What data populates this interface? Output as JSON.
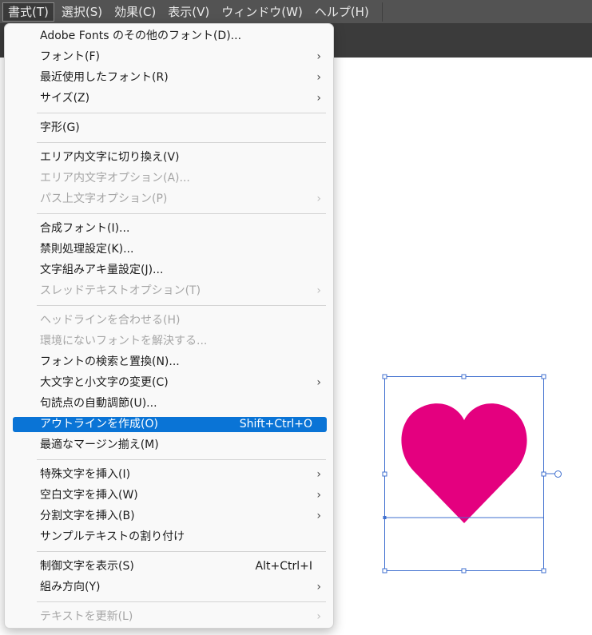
{
  "menubar": {
    "items": [
      {
        "label": "書式(T)"
      },
      {
        "label": "選択(S)"
      },
      {
        "label": "効果(C)"
      },
      {
        "label": "表示(V)"
      },
      {
        "label": "ウィンドウ(W)"
      },
      {
        "label": "ヘルプ(H)"
      }
    ]
  },
  "menu": {
    "items": [
      {
        "label": "Adobe Fonts のその他のフォント(D)..."
      },
      {
        "label": "フォント(F)"
      },
      {
        "label": "最近使用したフォント(R)"
      },
      {
        "label": "サイズ(Z)"
      },
      {
        "label": "字形(G)"
      },
      {
        "label": "エリア内文字に切り換え(V)"
      },
      {
        "label": "エリア内文字オプション(A)..."
      },
      {
        "label": "パス上文字オプション(P)"
      },
      {
        "label": "合成フォント(I)..."
      },
      {
        "label": "禁則処理設定(K)..."
      },
      {
        "label": "文字組みアキ量設定(J)..."
      },
      {
        "label": "スレッドテキストオプション(T)"
      },
      {
        "label": "ヘッドラインを合わせる(H)"
      },
      {
        "label": "環境にないフォントを解決する..."
      },
      {
        "label": "フォントの検索と置換(N)..."
      },
      {
        "label": "大文字と小文字の変更(C)"
      },
      {
        "label": "句読点の自動調節(U)..."
      },
      {
        "label": "アウトラインを作成(O)",
        "shortcut": "Shift+Ctrl+O"
      },
      {
        "label": "最適なマージン揃え(M)"
      },
      {
        "label": "特殊文字を挿入(I)"
      },
      {
        "label": "空白文字を挿入(W)"
      },
      {
        "label": "分割文字を挿入(B)"
      },
      {
        "label": "サンプルテキストの割り付け"
      },
      {
        "label": "制御文字を表示(S)",
        "shortcut": "Alt+Ctrl+I"
      },
      {
        "label": "組み方向(Y)"
      },
      {
        "label": "テキストを更新(L)"
      }
    ],
    "submenu_arrow": "›"
  },
  "artwork": {
    "shape": "heart-icon",
    "fill": "#e4007f",
    "selection_color": "#3f6fcf"
  }
}
